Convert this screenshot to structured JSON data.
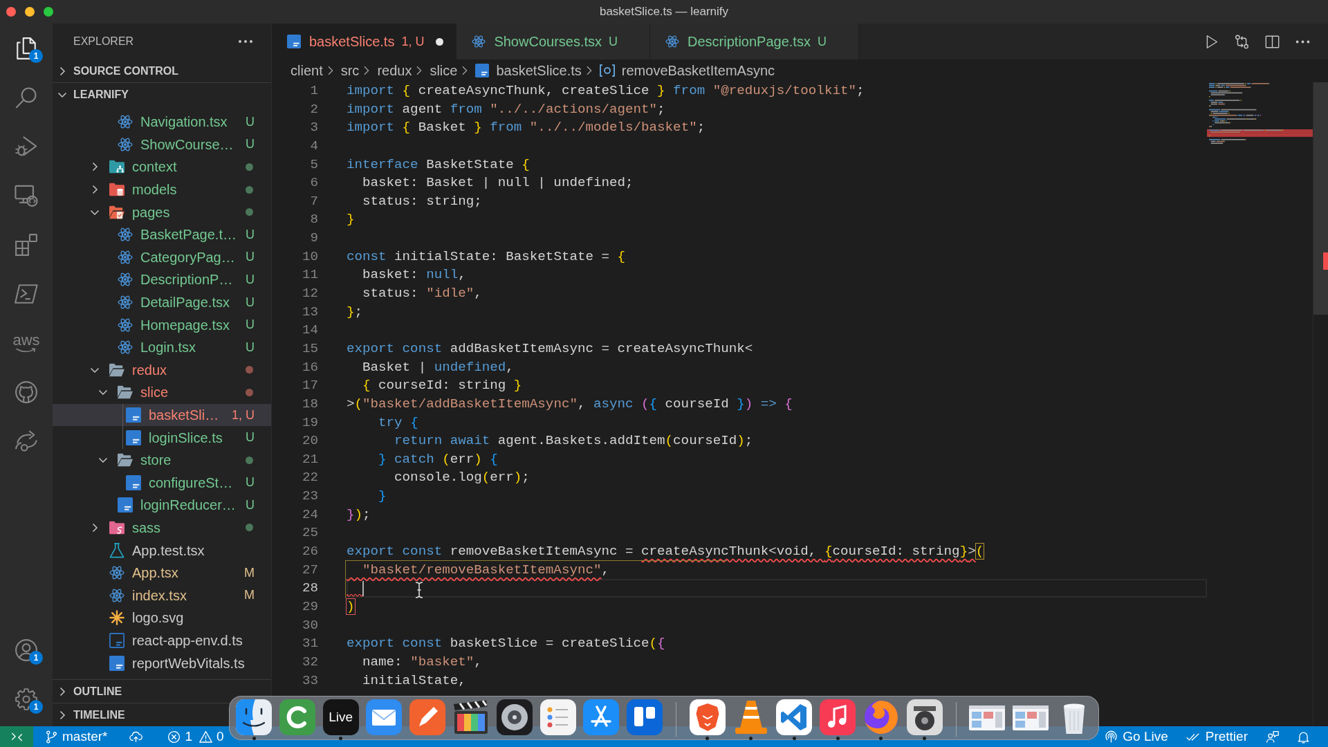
{
  "window": {
    "title": "basketSlice.ts — learnify"
  },
  "activity_bar": {
    "top": [
      {
        "kind": "files",
        "selected": true,
        "badge": "1"
      },
      {
        "kind": "search",
        "selected": false
      },
      {
        "kind": "debug",
        "selected": false
      },
      {
        "kind": "remote",
        "selected": false
      },
      {
        "kind": "extensions",
        "selected": false
      },
      {
        "kind": "terminal",
        "selected": false
      },
      {
        "kind": "wordmark",
        "label": "aws",
        "selected": false
      },
      {
        "kind": "github",
        "selected": false
      },
      {
        "kind": "share",
        "selected": false
      }
    ],
    "bottom": [
      {
        "kind": "account",
        "badge": "1"
      },
      {
        "kind": "settings",
        "badge": "1"
      }
    ]
  },
  "sidebar": {
    "title": "EXPLORER",
    "sections": [
      {
        "title": "SOURCE CONTROL",
        "expanded": false
      },
      {
        "title": "LEARNIFY",
        "expanded": true,
        "tree": [
          {
            "children": [
              {
                "label": "Navigation.tsx",
                "kind": "react",
                "status": "U",
                "color": "#73c991",
                "selected": false
              },
              {
                "label": "ShowCourse…",
                "kind": "react",
                "status": "U",
                "color": "#73c991",
                "selected": false
              }
            ]
          },
          {
            "label": "context",
            "kind": "network-folder",
            "color": "#73c991",
            "changed": true,
            "expanded": false,
            "selected": false
          },
          {
            "label": "models",
            "kind": "database-folder",
            "color": "#73c991",
            "changed": true,
            "expanded": false,
            "selected": false
          },
          {
            "label": "pages",
            "kind": "page-folder",
            "color": "#73c991",
            "changed": true,
            "expanded": true,
            "selected": false,
            "children": [
              {
                "label": "BasketPage.t…",
                "kind": "react",
                "status": "U",
                "color": "#73c991",
                "selected": false
              },
              {
                "label": "CategoryPag…",
                "kind": "react",
                "status": "U",
                "color": "#73c991",
                "selected": false
              },
              {
                "label": "DescriptionP…",
                "kind": "react",
                "status": "U",
                "color": "#73c991",
                "selected": false
              },
              {
                "label": "DetailPage.tsx",
                "kind": "react",
                "status": "U",
                "color": "#73c991",
                "selected": false
              },
              {
                "label": "Homepage.tsx",
                "kind": "react",
                "status": "U",
                "color": "#73c991",
                "selected": false
              },
              {
                "label": "Login.tsx",
                "kind": "react",
                "status": "U",
                "color": "#73c991",
                "selected": false
              }
            ]
          },
          {
            "label": "redux",
            "kind": "folder",
            "color": "#f88070",
            "changed": true,
            "expanded": true,
            "selected": false,
            "children": [
              {
                "label": "slice",
                "kind": "folder",
                "color": "#f88070",
                "changed": true,
                "expanded": true,
                "selected": false,
                "children": [
                  {
                    "label": "basketSli…",
                    "kind": "ts",
                    "status": "1, U",
                    "color": "#f88070",
                    "selected": true
                  },
                  {
                    "label": "loginSlice.ts",
                    "kind": "ts",
                    "status": "U",
                    "color": "#73c991",
                    "selected": false
                  }
                ]
              },
              {
                "label": "store",
                "kind": "folder",
                "color": "#73c991",
                "changed": true,
                "expanded": true,
                "selected": false,
                "children": [
                  {
                    "label": "configureSt…",
                    "kind": "ts",
                    "status": "U",
                    "color": "#73c991",
                    "selected": false
                  }
                ]
              },
              {
                "label": "loginReducer…",
                "kind": "ts",
                "status": "U",
                "color": "#73c991",
                "selected": false
              }
            ]
          },
          {
            "label": "sass",
            "kind": "style-folder",
            "color": "#73c991",
            "changed": true,
            "expanded": false,
            "selected": false
          },
          {
            "label": "App.test.tsx",
            "kind": "test",
            "color": "#cccccc",
            "selected": false
          },
          {
            "label": "App.tsx",
            "kind": "react",
            "status": "M",
            "color": "#e2c08d",
            "selected": false
          },
          {
            "label": "index.tsx",
            "kind": "react",
            "status": "M",
            "color": "#e2c08d",
            "selected": false
          },
          {
            "label": "logo.svg",
            "kind": "svg",
            "color": "#cccccc",
            "selected": false
          },
          {
            "label": "react-app-env.d.ts",
            "kind": "ts-outline",
            "color": "#cccccc",
            "selected": false
          },
          {
            "label": "reportWebVitals.ts",
            "kind": "ts",
            "color": "#cccccc",
            "selected": false
          }
        ]
      },
      {
        "title": "OUTLINE",
        "expanded": false
      },
      {
        "title": "TIMELINE",
        "expanded": false
      }
    ]
  },
  "editor": {
    "tabs": [
      {
        "label": "basketSlice.ts",
        "kind": "ts",
        "status": "1, U",
        "color": "#f88070",
        "dirty": true,
        "selected": true
      },
      {
        "label": "ShowCourses.tsx",
        "kind": "react",
        "status": "U",
        "color": "#73c991",
        "dirty": false,
        "selected": false
      },
      {
        "label": "DescriptionPage.tsx",
        "kind": "react",
        "status": "U",
        "color": "#73c991",
        "dirty": false,
        "selected": false
      }
    ],
    "actions": [
      {
        "kind": "run"
      },
      {
        "kind": "compare"
      },
      {
        "kind": "split"
      },
      {
        "kind": "more"
      }
    ],
    "breadcrumb": [
      {
        "text": "client",
        "kind": "folder"
      },
      {
        "text": "src",
        "kind": "folder"
      },
      {
        "text": "redux",
        "kind": "folder"
      },
      {
        "text": "slice",
        "kind": "folder"
      },
      {
        "text": "basketSlice.ts",
        "kind": "ts"
      },
      {
        "text": "removeBasketItemAsync",
        "kind": "symbol"
      }
    ],
    "lines": [
      {
        "number": "1",
        "current": false,
        "tokens": [
          {
            "text": "import ",
            "kind": "keyword",
            "error": false
          },
          {
            "text": "{",
            "kind": "bracket1",
            "error": false
          },
          {
            "text": " createAsyncThunk, createSlice ",
            "kind": "text",
            "error": false
          },
          {
            "text": "}",
            "kind": "bracket1",
            "error": false
          },
          {
            "text": " from ",
            "kind": "keyword",
            "error": false
          },
          {
            "text": "\"@reduxjs/toolkit\"",
            "kind": "string",
            "error": false
          },
          {
            "text": ";",
            "kind": "text",
            "error": false
          }
        ]
      },
      {
        "number": "2",
        "current": false,
        "tokens": [
          {
            "text": "import ",
            "kind": "keyword",
            "error": false
          },
          {
            "text": "agent",
            "kind": "text",
            "error": false
          },
          {
            "text": " from ",
            "kind": "keyword",
            "error": false
          },
          {
            "text": "\"../../actions/agent\"",
            "kind": "string",
            "error": false
          },
          {
            "text": ";",
            "kind": "text",
            "error": false
          }
        ]
      },
      {
        "number": "3",
        "current": false,
        "tokens": [
          {
            "text": "import ",
            "kind": "keyword",
            "error": false
          },
          {
            "text": "{",
            "kind": "bracket1",
            "error": false
          },
          {
            "text": " Basket ",
            "kind": "text",
            "error": false
          },
          {
            "text": "}",
            "kind": "bracket1",
            "error": false
          },
          {
            "text": " from ",
            "kind": "keyword",
            "error": false
          },
          {
            "text": "\"../../models/basket\"",
            "kind": "string",
            "error": false
          },
          {
            "text": ";",
            "kind": "text",
            "error": false
          }
        ]
      },
      {
        "number": "4",
        "current": false
      },
      {
        "number": "5",
        "current": false,
        "tokens": [
          {
            "text": "interface ",
            "kind": "keyword",
            "error": false
          },
          {
            "text": "BasketState ",
            "kind": "text",
            "error": false
          },
          {
            "text": "{",
            "kind": "bracket1",
            "error": false
          }
        ]
      },
      {
        "number": "6",
        "current": false,
        "tokens": [
          {
            "text": "  basket: Basket | null | undefined;",
            "kind": "text",
            "error": false
          }
        ]
      },
      {
        "number": "7",
        "current": false,
        "tokens": [
          {
            "text": "  status: string;",
            "kind": "text",
            "error": false
          }
        ]
      },
      {
        "number": "8",
        "current": false,
        "tokens": [
          {
            "text": "}",
            "kind": "bracket1",
            "error": false
          }
        ]
      },
      {
        "number": "9",
        "current": false
      },
      {
        "number": "10",
        "current": false,
        "tokens": [
          {
            "text": "const ",
            "kind": "keyword",
            "error": false
          },
          {
            "text": "initialState: BasketState = ",
            "kind": "text",
            "error": false
          },
          {
            "text": "{",
            "kind": "bracket1",
            "error": false
          }
        ]
      },
      {
        "number": "11",
        "current": false,
        "tokens": [
          {
            "text": "  basket: ",
            "kind": "text",
            "error": false
          },
          {
            "text": "null",
            "kind": "keyword",
            "error": false
          },
          {
            "text": ",",
            "kind": "text",
            "error": false
          }
        ]
      },
      {
        "number": "12",
        "current": false,
        "tokens": [
          {
            "text": "  status: ",
            "kind": "text",
            "error": false
          },
          {
            "text": "\"idle\"",
            "kind": "string",
            "error": false
          },
          {
            "text": ",",
            "kind": "text",
            "error": false
          }
        ]
      },
      {
        "number": "13",
        "current": false,
        "tokens": [
          {
            "text": "}",
            "kind": "bracket1",
            "error": false
          },
          {
            "text": ";",
            "kind": "text",
            "error": false
          }
        ]
      },
      {
        "number": "14",
        "current": false
      },
      {
        "number": "15",
        "current": false,
        "tokens": [
          {
            "text": "export const ",
            "kind": "keyword",
            "error": false
          },
          {
            "text": "addBasketItemAsync = createAsyncThunk<",
            "kind": "text",
            "error": false
          }
        ]
      },
      {
        "number": "16",
        "current": false,
        "tokens": [
          {
            "text": "  Basket | ",
            "kind": "text",
            "error": false
          },
          {
            "text": "undefined",
            "kind": "keyword",
            "error": false
          },
          {
            "text": ",",
            "kind": "text",
            "error": false
          }
        ]
      },
      {
        "number": "17",
        "current": false,
        "tokens": [
          {
            "text": "  {",
            "kind": "bracket1",
            "error": false
          },
          {
            "text": " courseId: string ",
            "kind": "text",
            "error": false
          },
          {
            "text": "}",
            "kind": "bracket1",
            "error": false
          }
        ]
      },
      {
        "number": "18",
        "current": false,
        "tokens": [
          {
            "text": ">",
            "kind": "text",
            "error": false
          },
          {
            "text": "(",
            "kind": "bracket1",
            "error": false
          },
          {
            "text": "\"basket/addBasketItemAsync\"",
            "kind": "string",
            "error": false
          },
          {
            "text": ", ",
            "kind": "text",
            "error": false
          },
          {
            "text": "async ",
            "kind": "keyword",
            "error": false
          },
          {
            "text": "(",
            "kind": "bracket2",
            "error": false
          },
          {
            "text": "{",
            "kind": "bracket3",
            "error": false
          },
          {
            "text": " courseId ",
            "kind": "text",
            "error": false
          },
          {
            "text": "}",
            "kind": "bracket3",
            "error": false
          },
          {
            "text": ")",
            "kind": "bracket2",
            "error": false
          },
          {
            "text": " => ",
            "kind": "keyword",
            "error": false
          },
          {
            "text": "{",
            "kind": "bracket2",
            "error": false
          }
        ]
      },
      {
        "number": "19",
        "current": false,
        "tokens": [
          {
            "text": "    try ",
            "kind": "keyword",
            "error": false
          },
          {
            "text": "{",
            "kind": "bracket3",
            "error": false
          }
        ]
      },
      {
        "number": "20",
        "current": false,
        "tokens": [
          {
            "text": "      return await ",
            "kind": "keyword",
            "error": false
          },
          {
            "text": "agent.Baskets.addItem",
            "kind": "text",
            "error": false
          },
          {
            "text": "(",
            "kind": "bracket1",
            "error": false
          },
          {
            "text": "courseId",
            "kind": "text",
            "error": false
          },
          {
            "text": ")",
            "kind": "bracket1",
            "error": false
          },
          {
            "text": ";",
            "kind": "text",
            "error": false
          }
        ]
      },
      {
        "number": "21",
        "current": false,
        "tokens": [
          {
            "text": "    }",
            "kind": "bracket3",
            "error": false
          },
          {
            "text": " catch ",
            "kind": "keyword",
            "error": false
          },
          {
            "text": "(",
            "kind": "bracket1",
            "error": false
          },
          {
            "text": "err",
            "kind": "text",
            "error": false
          },
          {
            "text": ")",
            "kind": "bracket1",
            "error": false
          },
          {
            "text": " {",
            "kind": "bracket3",
            "error": false
          }
        ]
      },
      {
        "number": "22",
        "current": false,
        "tokens": [
          {
            "text": "      console.log",
            "kind": "text",
            "error": false
          },
          {
            "text": "(",
            "kind": "bracket1",
            "error": false
          },
          {
            "text": "err",
            "kind": "text",
            "error": false
          },
          {
            "text": ")",
            "kind": "bracket1",
            "error": false
          },
          {
            "text": ";",
            "kind": "text",
            "error": false
          }
        ]
      },
      {
        "number": "23",
        "current": false,
        "tokens": [
          {
            "text": "    }",
            "kind": "bracket3",
            "error": false
          }
        ]
      },
      {
        "number": "24",
        "current": false,
        "tokens": [
          {
            "text": "}",
            "kind": "bracket2",
            "error": false
          },
          {
            "text": ")",
            "kind": "bracket1",
            "error": false
          },
          {
            "text": ";",
            "kind": "text",
            "error": false
          }
        ]
      },
      {
        "number": "25",
        "current": false
      },
      {
        "number": "26",
        "current": false,
        "tokens": [
          {
            "text": "export const ",
            "kind": "keyword",
            "error": false
          },
          {
            "text": "removeBasketItemAsync = ",
            "kind": "text",
            "error": false
          },
          {
            "text": "createAsyncThunk<void, ",
            "kind": "text",
            "error": true
          },
          {
            "text": "{",
            "kind": "bracket1",
            "error": true
          },
          {
            "text": "courseId: string",
            "kind": "text",
            "error": true
          },
          {
            "text": "}",
            "kind": "bracket1",
            "error": true
          },
          {
            "text": ">",
            "kind": "text",
            "error": true
          },
          {
            "text": "(",
            "kind": "match",
            "error": false
          }
        ]
      },
      {
        "number": "27",
        "current": false,
        "tokens": [
          {
            "text": "  \"basket/removeBasketItemAsync\"",
            "kind": "string",
            "error": true
          },
          {
            "text": ",",
            "kind": "text",
            "error": false
          }
        ]
      },
      {
        "number": "28",
        "current": true
      },
      {
        "number": "29",
        "current": false,
        "tokens": [
          {
            "text": ")",
            "kind": "match",
            "error": true
          }
        ]
      },
      {
        "number": "30",
        "current": false
      },
      {
        "number": "31",
        "current": false,
        "tokens": [
          {
            "text": "export const ",
            "kind": "keyword",
            "error": false
          },
          {
            "text": "basketSlice = createSlice",
            "kind": "text",
            "error": false
          },
          {
            "text": "(",
            "kind": "bracket1",
            "error": false
          },
          {
            "text": "{",
            "kind": "bracket2",
            "error": false
          }
        ]
      },
      {
        "number": "32",
        "current": false,
        "tokens": [
          {
            "text": "  name: ",
            "kind": "text",
            "error": false
          },
          {
            "text": "\"basket\"",
            "kind": "string",
            "error": false
          },
          {
            "text": ",",
            "kind": "text",
            "error": false
          }
        ]
      },
      {
        "number": "33",
        "current": false,
        "tokens": [
          {
            "text": "  initialState,",
            "kind": "text",
            "error": false
          }
        ]
      }
    ]
  },
  "status_bar": {
    "left": [
      {
        "kind": "remote"
      },
      {
        "kind": "branch",
        "text": "master*"
      },
      {
        "kind": "sync"
      },
      {
        "kind": "errors",
        "text": "1"
      },
      {
        "kind": "warnings",
        "text": "0"
      }
    ],
    "right": [
      {
        "kind": "live",
        "text": "Go Live"
      },
      {
        "kind": "formatter",
        "text": "Prettier"
      },
      {
        "kind": "feedback"
      },
      {
        "kind": "notifications"
      }
    ]
  },
  "dock": {
    "sections": [
      {
        "items": [
          {
            "kind": "face",
            "running": true
          },
          {
            "kind": "ring",
            "running": false
          },
          {
            "kind": "label",
            "label": "Live",
            "running": true
          },
          {
            "kind": "envelope",
            "running": false
          },
          {
            "kind": "pen",
            "running": false
          },
          {
            "kind": "clapperboard",
            "running": false
          },
          {
            "kind": "disc",
            "running": false
          },
          {
            "kind": "list",
            "running": false
          },
          {
            "kind": "sticks",
            "running": false
          },
          {
            "kind": "board",
            "running": false
          }
        ]
      },
      {
        "items": [
          {
            "kind": "shield",
            "running": true
          },
          {
            "kind": "cone",
            "running": true
          },
          {
            "kind": "ribbon",
            "running": true
          },
          {
            "kind": "note",
            "running": true
          },
          {
            "kind": "globe",
            "running": true
          },
          {
            "kind": "reel",
            "running": true
          }
        ]
      },
      {
        "items": [
          {
            "kind": "window",
            "running": false
          },
          {
            "kind": "window",
            "running": false
          },
          {
            "kind": "trash",
            "running": false
          }
        ]
      }
    ]
  }
}
